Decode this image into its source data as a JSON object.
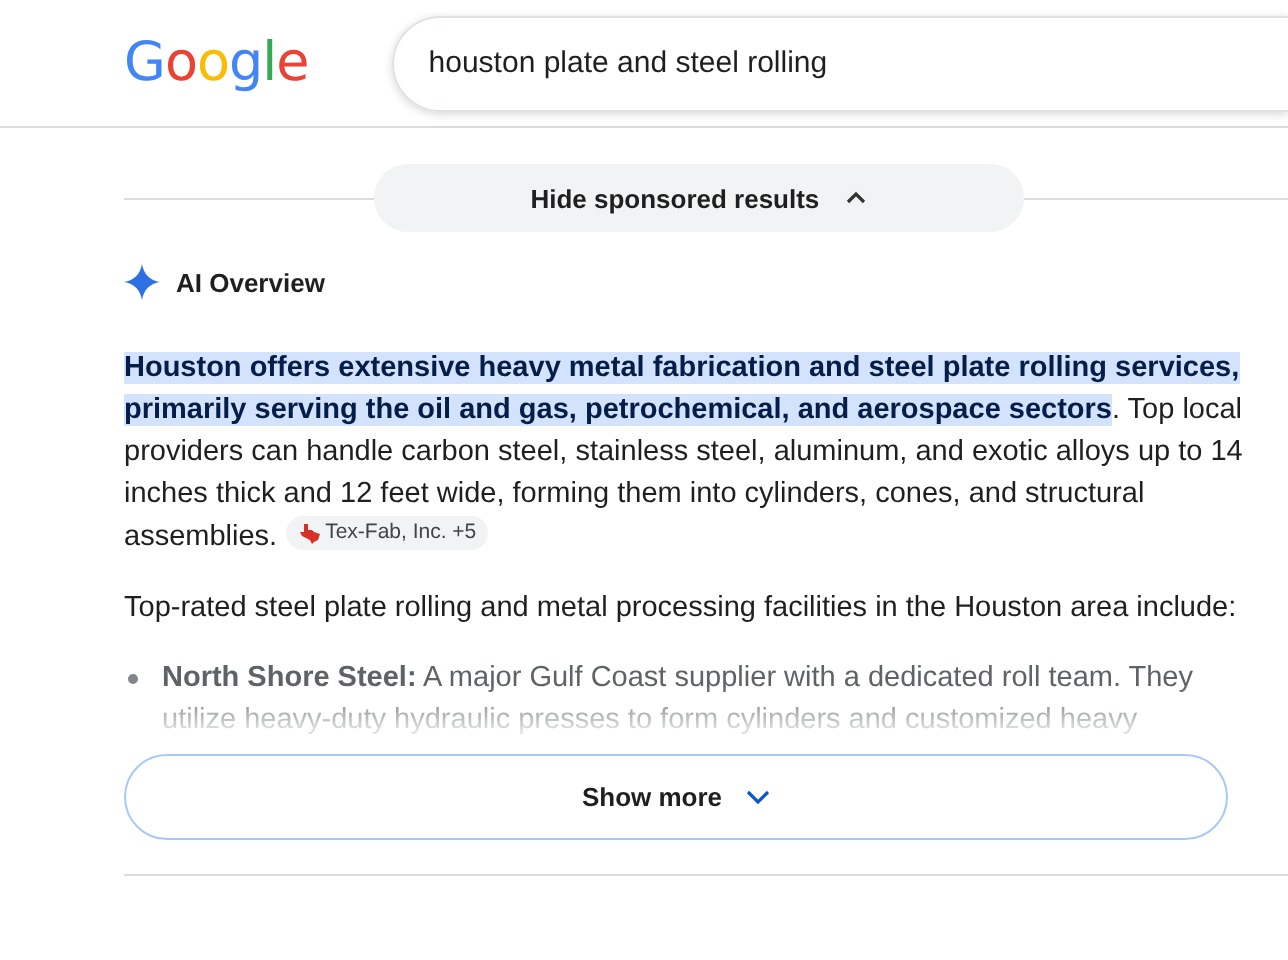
{
  "header": {
    "logo": "Google",
    "query": "houston plate and steel rolling"
  },
  "sponsored": {
    "label": "Hide sponsored results",
    "expanded": true
  },
  "overview": {
    "title": "AI Overview",
    "highlight": "Houston offers extensive heavy metal fabrication and steel plate rolling services, primarily serving the oil and gas, petrochemical, and aerospace sectors",
    "text": ". Top local providers can handle carbon steel, stainless steel, aluminum, and exotic alloys up to 14 inches thick and 12 feet wide, forming them into cylinders, cones, and structural",
    "text_end": "assemblies.",
    "citation": "Tex-Fab, Inc. +5",
    "intro": "Top-rated steel plate rolling and metal processing facilities in the Houston area include:",
    "items": [
      "**North Shore Steel:** A major Gulf Coast supplier with a dedicated roll team. They utilize heavy-duty hydraulic presses to form cylinders and customized heavy"
    ],
    "show_more": "Show more"
  }
}
